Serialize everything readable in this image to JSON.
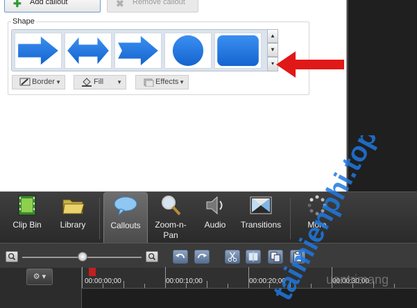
{
  "top_buttons": {
    "add_label": "Add callout",
    "remove_label": "Remove callout"
  },
  "shape_group": {
    "label": "Shape",
    "shapes": [
      "arrow-right",
      "arrow-both",
      "arrow-right-notched",
      "circle",
      "rounded-rectangle"
    ]
  },
  "options": {
    "border_label": "Border",
    "fill_label": "Fill",
    "effects_label": "Effects"
  },
  "tabs": [
    {
      "label": "Clip Bin",
      "icon": "film-strip-icon"
    },
    {
      "label": "Library",
      "icon": "folder-icon"
    },
    {
      "label": "Callouts",
      "icon": "speech-bubble-icon"
    },
    {
      "label": "Zoom-n-\nPan",
      "icon": "magnifier-icon"
    },
    {
      "label": "Audio",
      "icon": "speaker-icon"
    },
    {
      "label": "Transitions",
      "icon": "transition-icon"
    },
    {
      "label": "More",
      "icon": "more-dots-icon"
    }
  ],
  "timeline": {
    "times": [
      "00:00:00;00",
      "00:00:10;00",
      "00:00:20;00",
      "00:00:30;00"
    ]
  },
  "watermark": {
    "text": "taimienphi.top",
    "subtext": "uantrimang"
  },
  "colors": {
    "accent_blue": "#1f78e0",
    "red_arrow": "#e01818"
  }
}
